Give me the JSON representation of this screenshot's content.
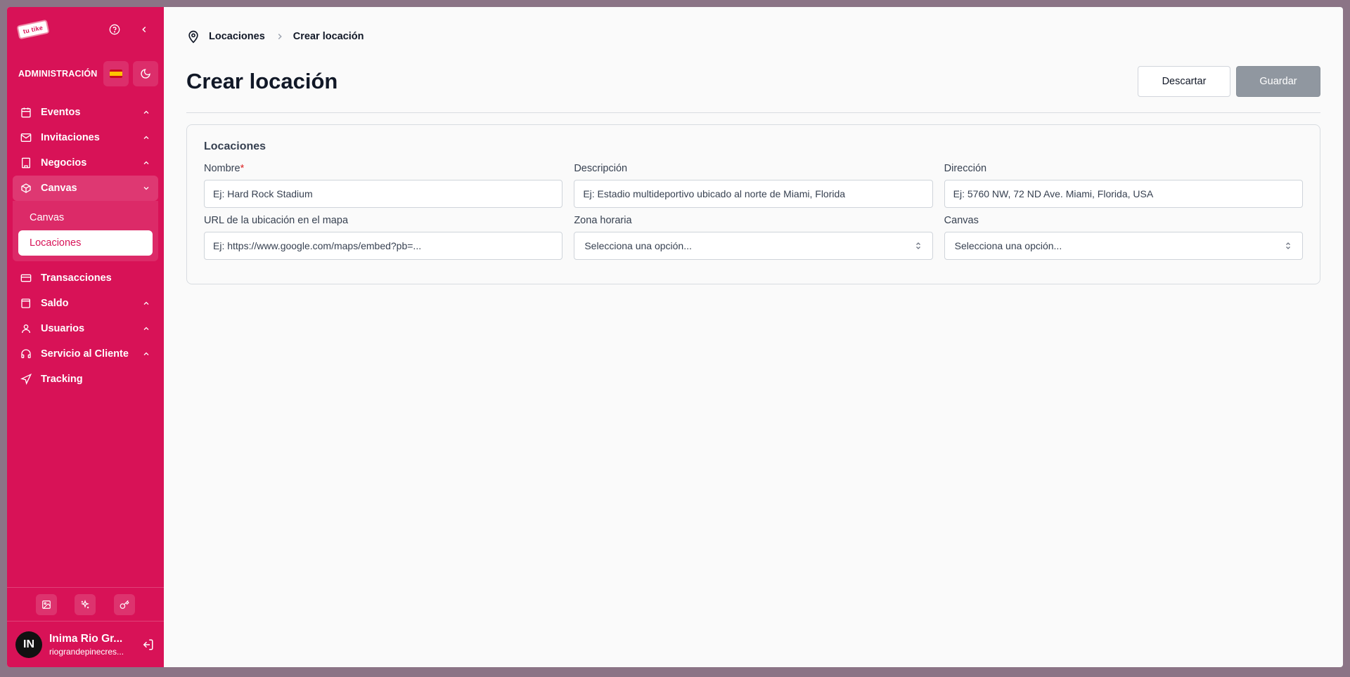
{
  "app": {
    "logo_text": "tu tike"
  },
  "sidebar": {
    "admin_label": "ADMINISTRACIÓN",
    "items": [
      {
        "label": "Eventos",
        "icon": "calendar-icon",
        "chevron": "up"
      },
      {
        "label": "Invitaciones",
        "icon": "mail-icon",
        "chevron": "up"
      },
      {
        "label": "Negocios",
        "icon": "building-icon",
        "chevron": "up"
      },
      {
        "label": "Canvas",
        "icon": "box-icon",
        "chevron": "down",
        "active": true
      },
      {
        "label": "Transacciones",
        "icon": "credit-card-icon"
      },
      {
        "label": "Saldo",
        "icon": "wallet-icon",
        "chevron": "up"
      },
      {
        "label": "Usuarios",
        "icon": "user-icon",
        "chevron": "up"
      },
      {
        "label": "Servicio al Cliente",
        "icon": "headset-icon",
        "chevron": "up"
      },
      {
        "label": "Tracking",
        "icon": "send-icon"
      }
    ],
    "subitems": [
      {
        "label": "Canvas"
      },
      {
        "label": "Locaciones",
        "current": true
      }
    ]
  },
  "user": {
    "initials": "IN",
    "name": "Inima Rio Gr...",
    "email": "riograndepinecres..."
  },
  "breadcrumb": {
    "parent": "Locaciones",
    "current": "Crear locación"
  },
  "header": {
    "title": "Crear locación",
    "discard_label": "Descartar",
    "save_label": "Guardar"
  },
  "form": {
    "section_title": "Locaciones",
    "nombre": {
      "label": "Nombre",
      "required_mark": "*",
      "placeholder": "Ej: Hard Rock Stadium"
    },
    "descripcion": {
      "label": "Descripción",
      "placeholder": "Ej: Estadio multideportivo ubicado al norte de Miami, Florida"
    },
    "direccion": {
      "label": "Dirección",
      "placeholder": "Ej: 5760 NW, 72 ND Ave. Miami, Florida, USA"
    },
    "url_mapa": {
      "label": "URL de la ubicación en el mapa",
      "placeholder": "Ej: https://www.google.com/maps/embed?pb=..."
    },
    "zona_horaria": {
      "label": "Zona horaria",
      "value": "Selecciona una opción..."
    },
    "canvas": {
      "label": "Canvas",
      "value": "Selecciona una opción..."
    }
  },
  "colors": {
    "brand": "#d81257",
    "disabled_button": "#9097a0",
    "required": "#dc2626"
  }
}
